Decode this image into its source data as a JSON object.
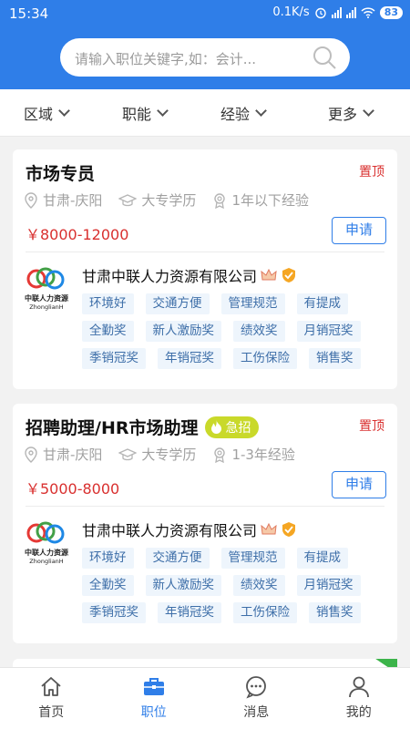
{
  "statusbar": {
    "time": "15:34",
    "speed": "0.1K/s",
    "battery": "83"
  },
  "search": {
    "placeholder": "请输入职位关键字,如：会计..."
  },
  "filters": [
    "区域",
    "职能",
    "经验",
    "更多"
  ],
  "jobs": [
    {
      "title": "市场专员",
      "urgent": "",
      "pin": "置顶",
      "location": "甘肃-庆阳",
      "education": "大专学历",
      "experience": "1年以下经验",
      "salary": "￥8000-12000",
      "apply": "申请",
      "logo_text": "中联人力资源",
      "logo_subtext": "ZhonglianH",
      "company": "甘肃中联人力资源有限公司",
      "tags": [
        "环境好",
        "交通方便",
        "管理规范",
        "有提成",
        "全勤奖",
        "新人激励奖",
        "绩效奖",
        "月销冠奖",
        "季销冠奖",
        "年销冠奖",
        "工伤保险",
        "销售奖"
      ]
    },
    {
      "title": "招聘助理/HR市场助理",
      "urgent": "急招",
      "pin": "置顶",
      "location": "甘肃-庆阳",
      "education": "大专学历",
      "experience": "1-3年经验",
      "salary": "￥5000-8000",
      "apply": "申请",
      "logo_text": "中联人力资源",
      "logo_subtext": "ZhonglianH",
      "company": "甘肃中联人力资源有限公司",
      "tags": [
        "环境好",
        "交通方便",
        "管理规范",
        "有提成",
        "全勤奖",
        "新人激励奖",
        "绩效奖",
        "月销冠奖",
        "季销冠奖",
        "年销冠奖",
        "工伤保险",
        "销售奖"
      ]
    }
  ],
  "nav": [
    {
      "label": "首页",
      "icon": "home-icon",
      "active": false
    },
    {
      "label": "职位",
      "icon": "briefcase-icon",
      "active": true
    },
    {
      "label": "消息",
      "icon": "chat-icon",
      "active": false
    },
    {
      "label": "我的",
      "icon": "user-icon",
      "active": false
    }
  ],
  "colors": {
    "primary": "#2f7ee8",
    "salary": "#d9302f",
    "urgent": "#c9d92a",
    "tag_bg": "#eef5fc",
    "tag_text": "#3d6ea8"
  }
}
